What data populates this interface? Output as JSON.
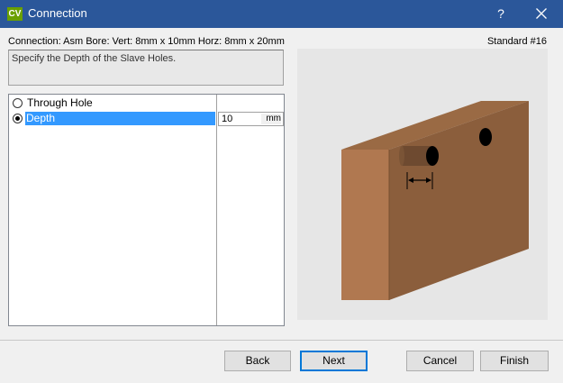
{
  "window": {
    "app_icon_text": "CV",
    "title": "Connection",
    "help_label": "?"
  },
  "header": {
    "connection_info": "Connection: Asm Bore: Vert: 8mm x 10mm Horz: 8mm x 20mm",
    "standard_label": "Standard #16"
  },
  "instructions": "Specify the Depth of the Slave Holes.",
  "options": [
    {
      "label": "Through Hole",
      "checked": false
    },
    {
      "label": "Depth",
      "checked": true,
      "value": "10",
      "unit": "mm"
    }
  ],
  "colors": {
    "titlebar": "#2b579a",
    "selection": "#3399ff",
    "board_front": "#b07850",
    "board_side": "#8b5e3c",
    "board_top": "#9a6a44"
  },
  "buttons": {
    "back": "Back",
    "next": "Next",
    "cancel": "Cancel",
    "finish": "Finish"
  }
}
